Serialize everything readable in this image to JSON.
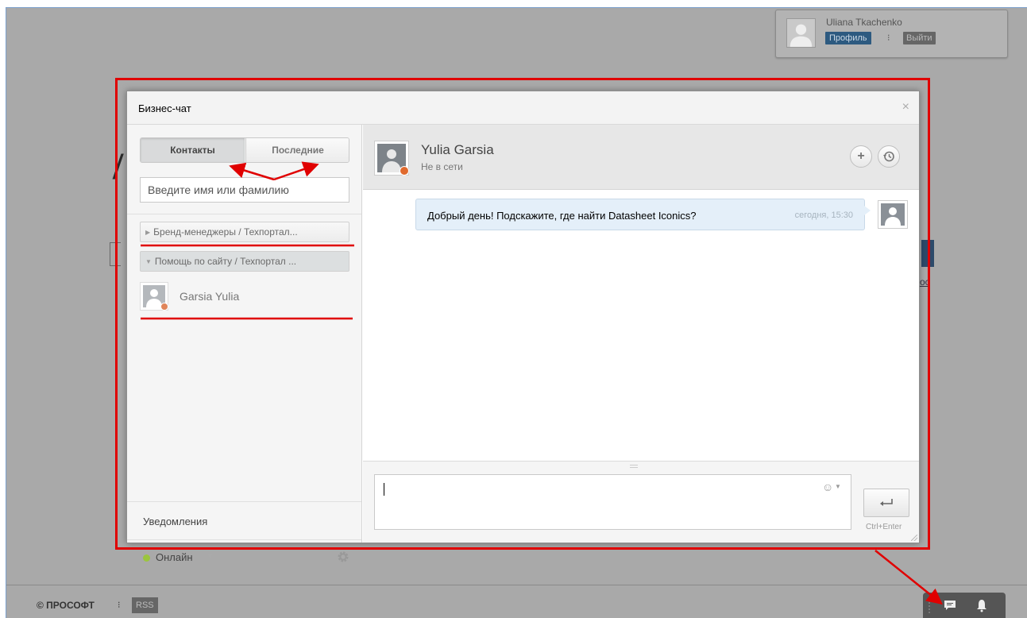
{
  "user_panel": {
    "name": "Uliana Tkachenko",
    "profile_label": "Профиль",
    "separator": "⁝",
    "logout_label": "Выйти"
  },
  "footer": {
    "copyright": "© ПРОСОФТ",
    "separator": "⁝",
    "rss_label": "RSS"
  },
  "background": {
    "logo_fragment": "/",
    "link_fragment": "ос"
  },
  "dialog": {
    "title": "Бизнес-чат",
    "close_icon": "×"
  },
  "sidebar": {
    "tabs": [
      {
        "label": "Контакты",
        "active": true
      },
      {
        "label": "Последние",
        "active": false
      }
    ],
    "search_placeholder": "Введите имя или фамилию",
    "groups": [
      {
        "label": "Бренд-менеджеры / Техпортал...",
        "expanded": false
      },
      {
        "label": "Помощь по сайту / Техпортал ...",
        "expanded": true
      }
    ],
    "contacts": [
      {
        "name": "Garsia Yulia",
        "status": "offline"
      }
    ],
    "notifications_label": "Уведомления",
    "status_label": "Онлайн"
  },
  "chat": {
    "contact_name": "Yulia Garsia",
    "contact_status": "Не в сети",
    "messages": [
      {
        "text": "Добрый день! Подскажите, где найти Datasheet Iconics?",
        "time": "сегодня, 15:30"
      }
    ],
    "input_value": "",
    "send_hint": "Ctrl+Enter",
    "add_icon": "+",
    "smiley": "☺"
  },
  "colors": {
    "annotation_red": "#e00000",
    "status_online": "#9bc53d",
    "status_offline": "#e06a2e",
    "bubble_bg": "#e4eff9"
  }
}
